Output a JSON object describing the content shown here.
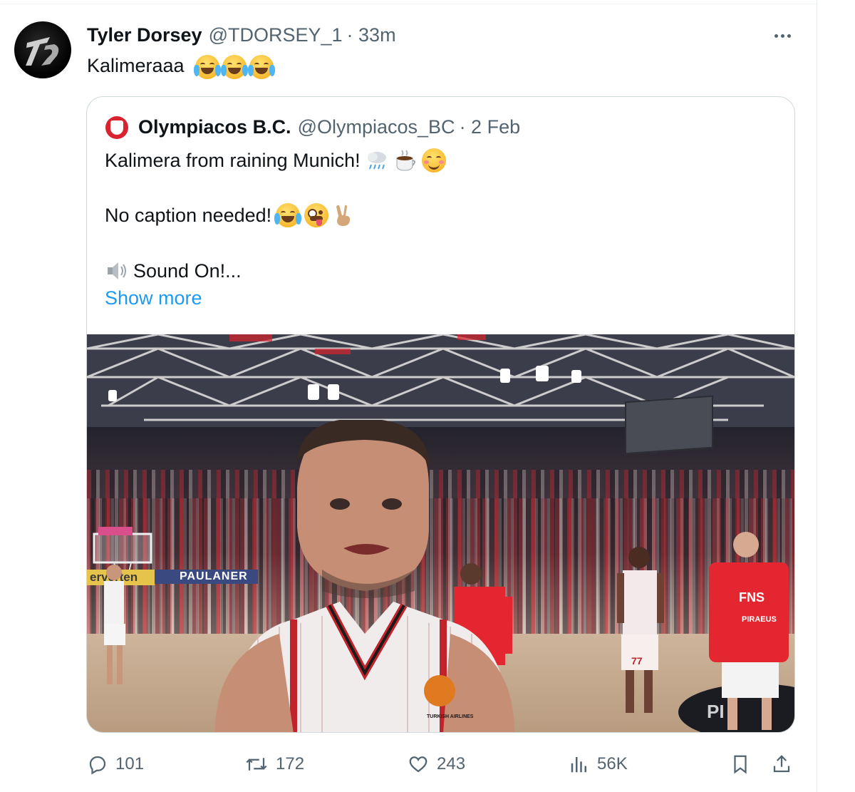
{
  "tweet": {
    "author_name": "Tyler Dorsey",
    "handle": "@TDORSEY_1",
    "time": "· 33m",
    "text": "Kalimeraaa",
    "emojis": [
      "face-with-tears-of-joy",
      "face-with-tears-of-joy",
      "face-with-tears-of-joy"
    ]
  },
  "quoted": {
    "author_name": "Olympiacos B.C.",
    "handle": "@Olympiacos_BC",
    "date": "· 2 Feb",
    "line1": "Kalimera from raining Munich!",
    "line1_emojis": [
      "cloud-with-rain",
      "hot-beverage",
      "smiling-face"
    ],
    "line2": "No caption needed!",
    "line2_emojis": [
      "face-with-tears-of-joy",
      "zany-face",
      "victory-hand"
    ],
    "line3": "Sound On!...",
    "line3_icon": "speaker-icon",
    "show_more": "Show more",
    "media_text": {
      "ad_banner": "PAULANER",
      "ad_banner_left": "erverten",
      "jersey_logo": "TURKISH AIRLINES",
      "player_number": "77",
      "sponsor": "FNS",
      "team_word": "PIRAEUS"
    }
  },
  "actions": {
    "replies": "101",
    "reposts": "172",
    "likes": "243",
    "views": "56K"
  },
  "colors": {
    "text": "#0f1419",
    "muted": "#536471",
    "link": "#1d9bf0",
    "border": "#cfd9de",
    "olympiacos_red": "#d9232e"
  }
}
